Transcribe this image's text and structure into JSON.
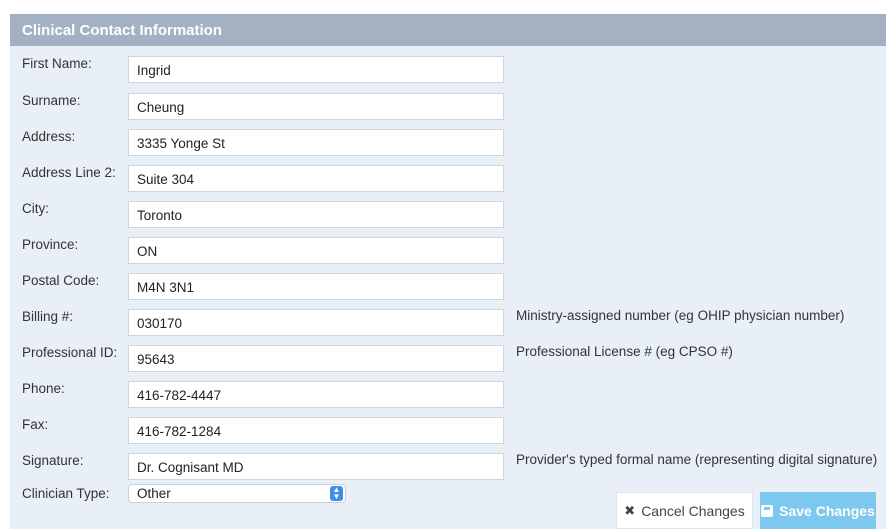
{
  "panel": {
    "title": "Clinical Contact Information"
  },
  "fields": {
    "first_name": {
      "label": "First Name:",
      "value": "Ingrid"
    },
    "surname": {
      "label": "Surname:",
      "value": "Cheung"
    },
    "address": {
      "label": "Address:",
      "value": "3335 Yonge St"
    },
    "address2": {
      "label": "Address Line 2:",
      "value": "Suite 304"
    },
    "city": {
      "label": "City:",
      "value": "Toronto"
    },
    "province": {
      "label": "Province:",
      "value": "ON"
    },
    "postal": {
      "label": "Postal Code:",
      "value": "M4N 3N1"
    },
    "billing": {
      "label": "Billing #:",
      "value": "030170",
      "hint": "Ministry-assigned number (eg OHIP physician number)"
    },
    "professional": {
      "label": "Professional ID:",
      "value": "95643",
      "hint": "Professional License # (eg CPSO #)"
    },
    "phone": {
      "label": "Phone:",
      "value": "416-782-4447"
    },
    "fax": {
      "label": "Fax:",
      "value": "416-782-1284"
    },
    "signature": {
      "label": "Signature:",
      "value": "Dr. Cognisant MD",
      "hint": "Provider's typed formal name (representing digital signature)"
    },
    "clinician_type": {
      "label": "Clinician Type:",
      "value": "Other"
    }
  },
  "buttons": {
    "cancel": "Cancel Changes",
    "save": "Save Changes"
  },
  "colors": {
    "header": "#a4b1c3",
    "panel_bg": "#e9eff6",
    "save_button": "#7cc8ef",
    "select_arrow": "#3e8ee8"
  }
}
